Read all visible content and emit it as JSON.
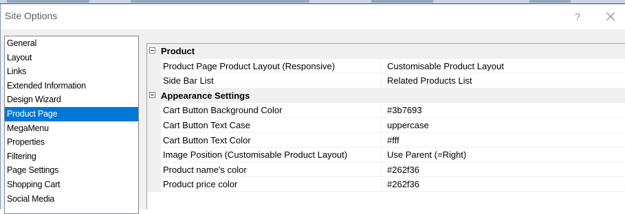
{
  "window": {
    "title": "Site Options",
    "help_glyph": "?",
    "close_icon": "close-icon"
  },
  "sidebar": {
    "items": [
      {
        "label": "General"
      },
      {
        "label": "Layout"
      },
      {
        "label": "Links"
      },
      {
        "label": "Extended Information"
      },
      {
        "label": "Design Wizard"
      },
      {
        "label": "Product Page",
        "selected": true
      },
      {
        "label": "MegaMenu"
      },
      {
        "label": "Properties"
      },
      {
        "label": "Filtering"
      },
      {
        "label": "Page Settings"
      },
      {
        "label": "Shopping Cart"
      },
      {
        "label": "Social Media"
      }
    ]
  },
  "grid": {
    "sections": [
      {
        "label": "Product",
        "expanded": true,
        "rows": [
          {
            "name": "Product Page Product Layout (Responsive)",
            "value": "Customisable Product Layout"
          },
          {
            "name": "Side Bar List",
            "value": "Related Products List"
          }
        ]
      },
      {
        "label": "Appearance Settings",
        "expanded": true,
        "rows": [
          {
            "name": "Cart Button Background Color",
            "value": "#3b7693"
          },
          {
            "name": "Cart Button Text Case",
            "value": "uppercase"
          },
          {
            "name": "Cart Button Text Color",
            "value": "#fff"
          },
          {
            "name": "Image Position (Customisable Product Layout)",
            "value": "Use Parent (=Right)"
          },
          {
            "name": "Product name's color",
            "value": "#262f36"
          },
          {
            "name": "Product price color",
            "value": "#262f36"
          }
        ]
      }
    ]
  },
  "colors": {
    "selection": "#0078d7",
    "category_background": "#f0f0f0",
    "window_background": "#f0f0f0"
  }
}
